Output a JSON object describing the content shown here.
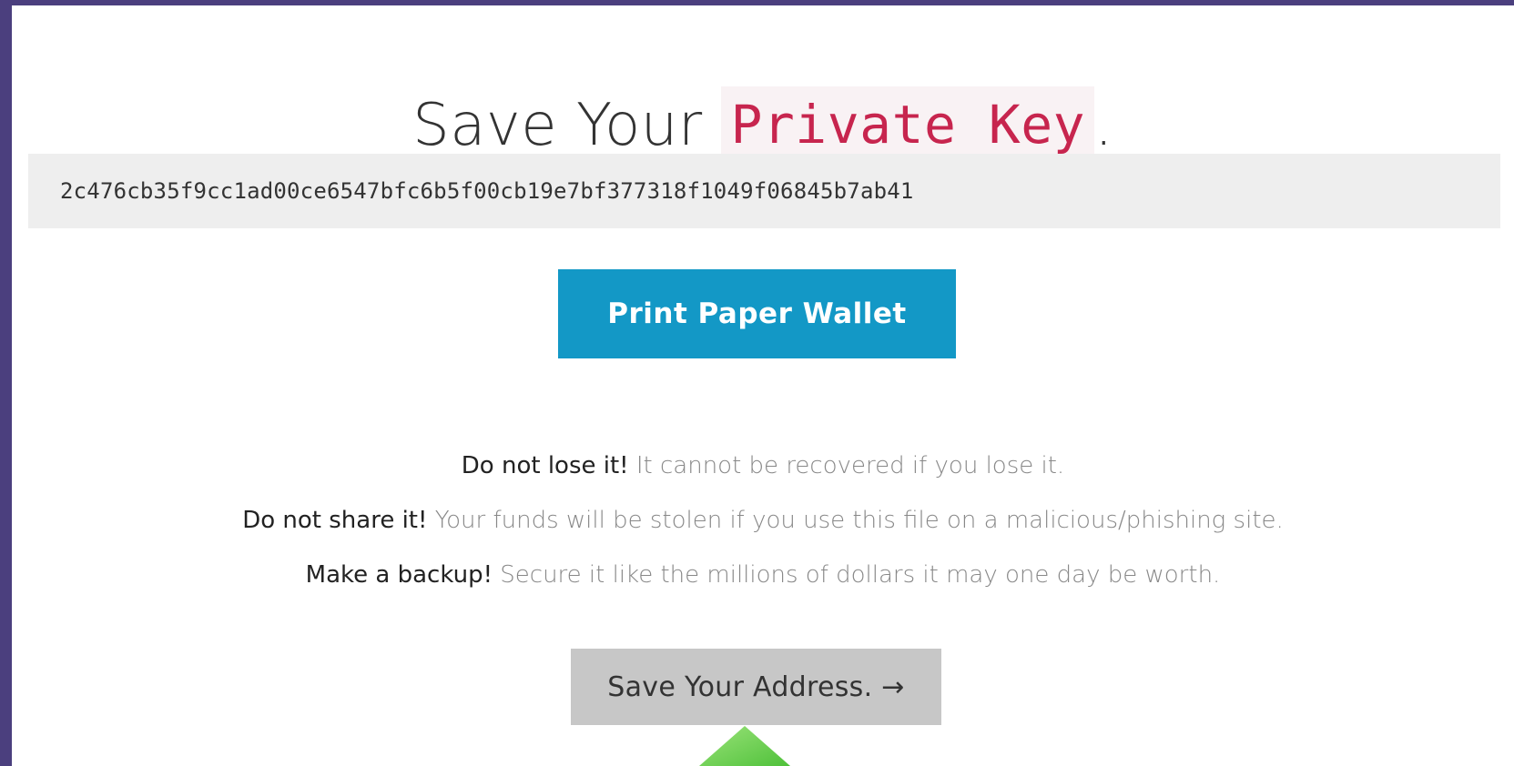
{
  "header": {
    "title_prefix": "Save Your ",
    "title_code": "Private Key",
    "title_suffix": "."
  },
  "private_key": {
    "value": "2c476cb35f9cc1ad00ce6547bfc6b5f00cb19e7bf377318f1049f06845b7ab41"
  },
  "actions": {
    "print_label": "Print Paper Wallet",
    "next_label": "Save Your Address. →"
  },
  "warnings": [
    {
      "strong": "Do not lose it!",
      "text": "It cannot be recovered if you lose it."
    },
    {
      "strong": "Do not share it!",
      "text": "Your funds will be stolen if you use this file on a malicious/phishing site."
    },
    {
      "strong": "Make a backup!",
      "text": "Secure it like the millions of dollars it may one day be worth."
    }
  ],
  "colors": {
    "frame": "#4b3f7e",
    "primary_button": "#1398c6",
    "secondary_button": "#c7c7c7",
    "code_text": "#c7254e",
    "code_bg": "#f9f2f4",
    "pointer_arrow": "#7ed957"
  },
  "icons": {
    "pointer": "up-arrow-icon"
  }
}
